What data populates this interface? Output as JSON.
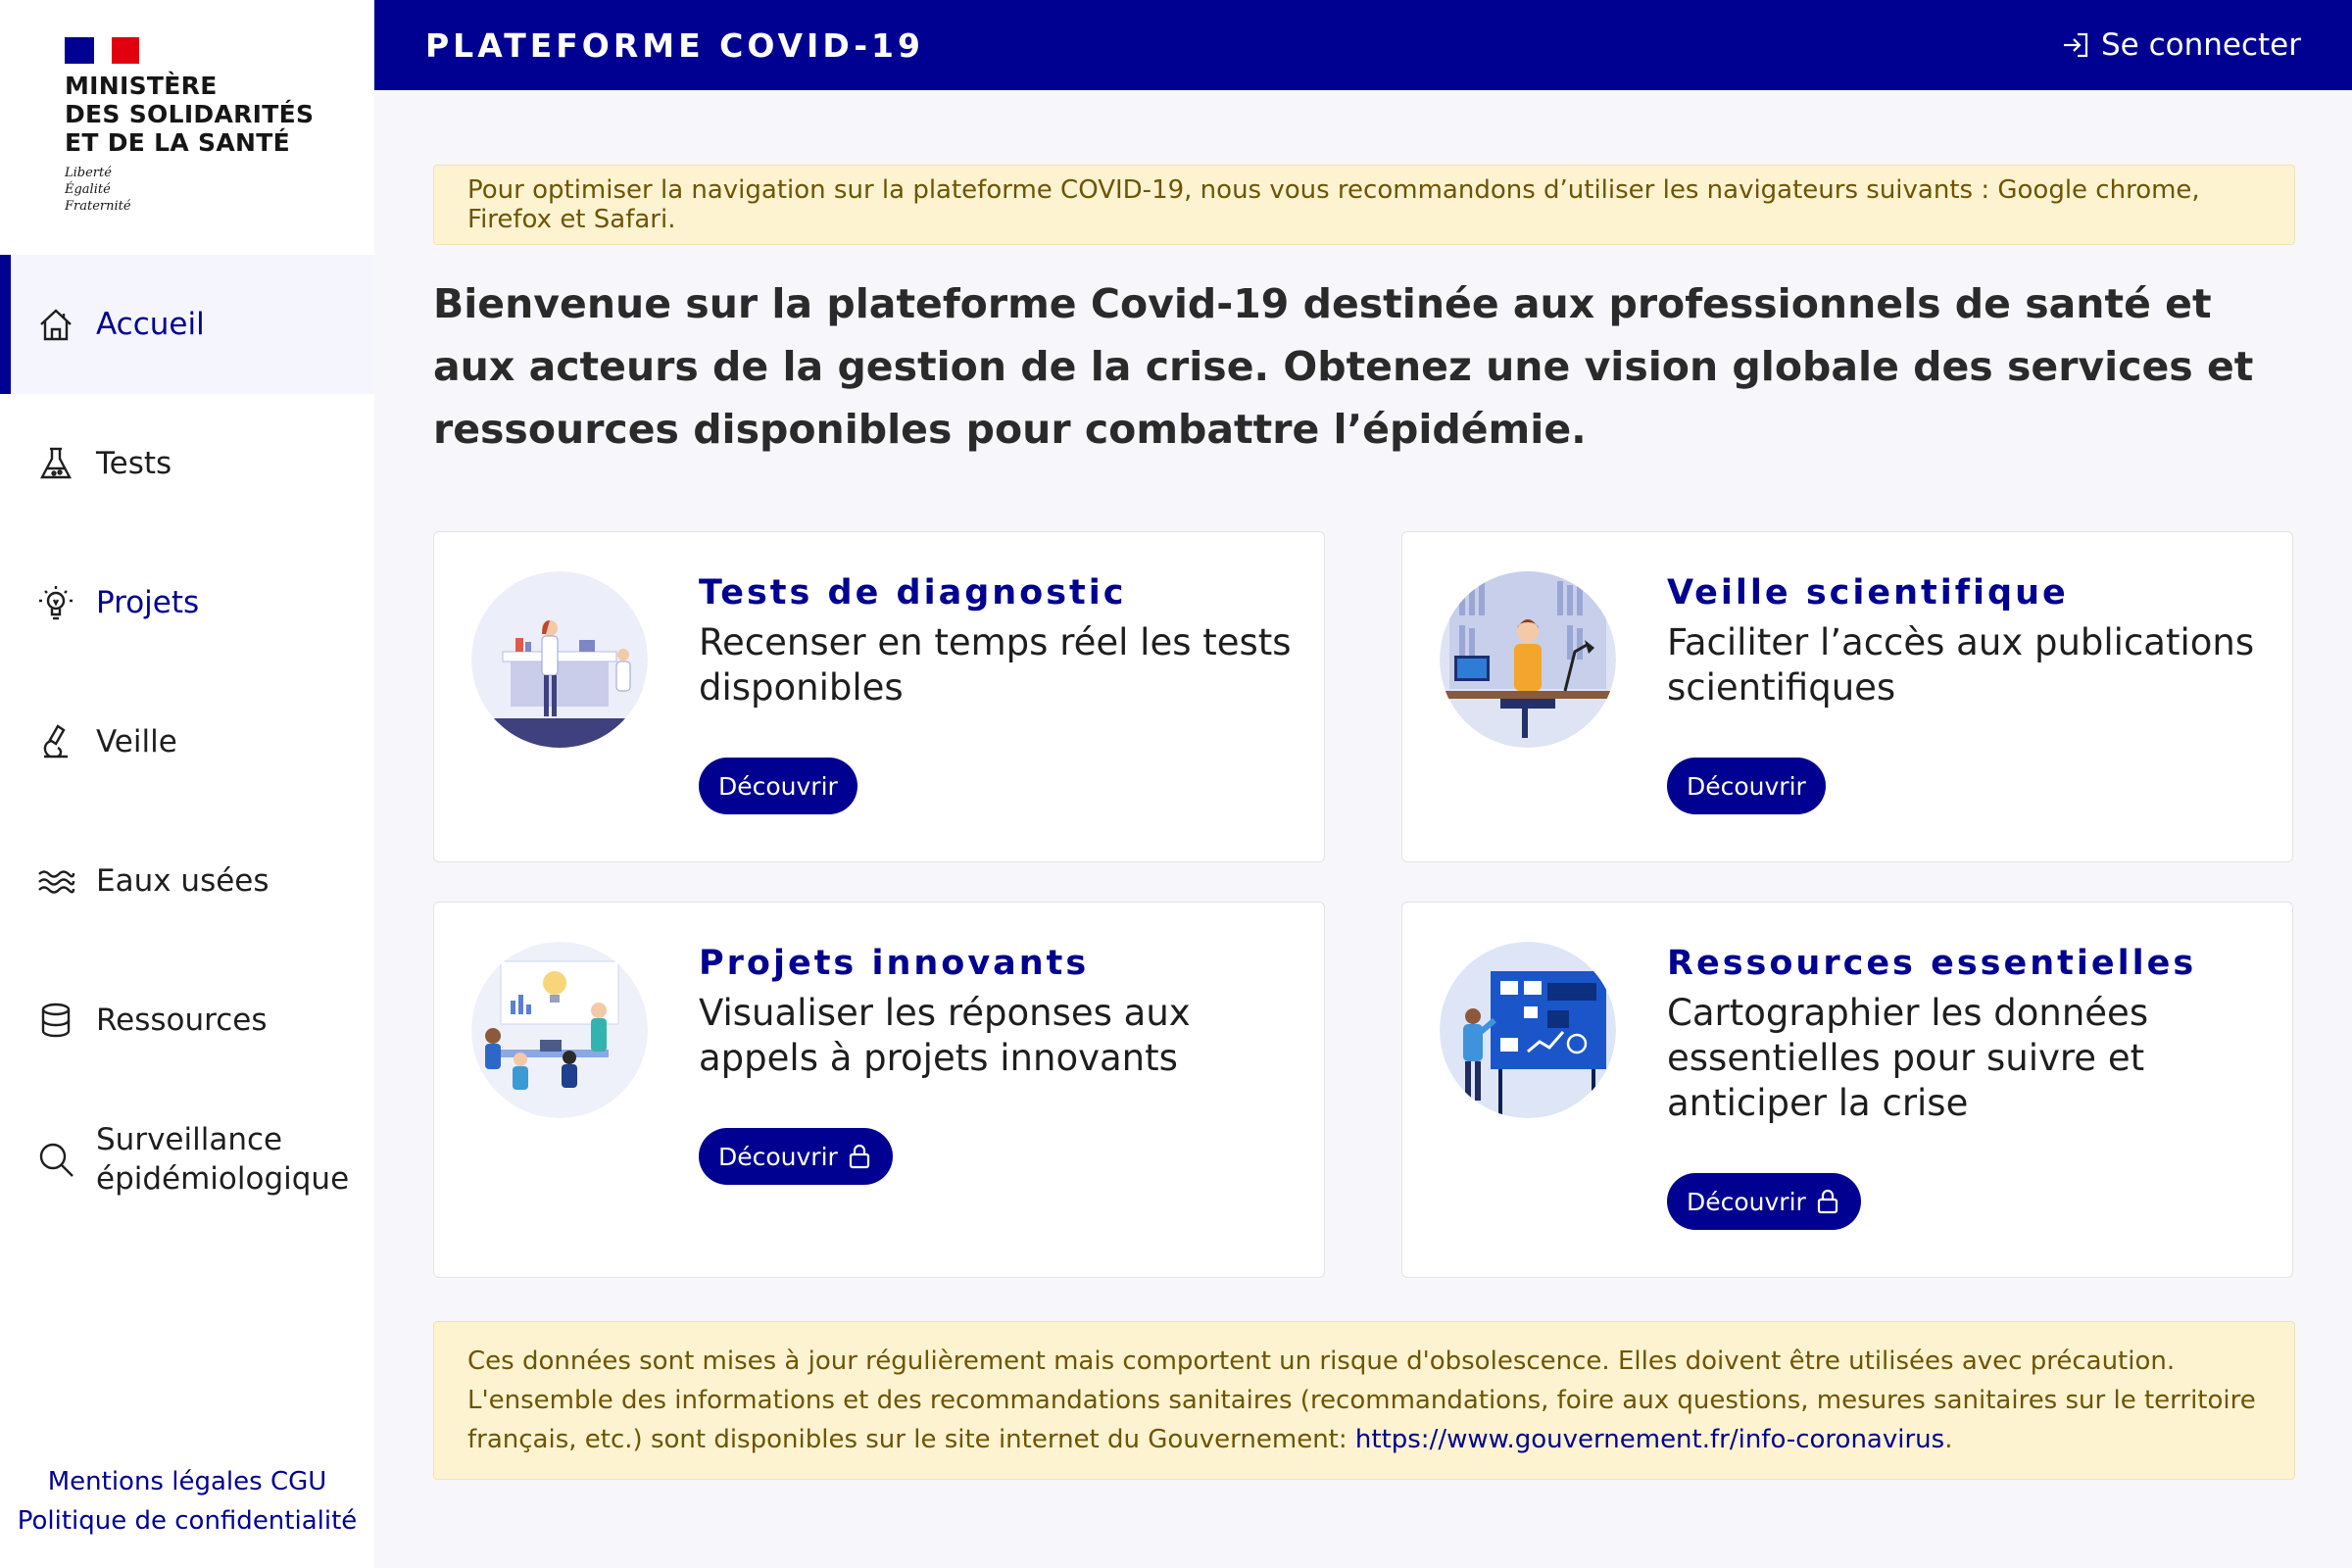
{
  "ministry": {
    "lines": [
      "MINISTÈRE",
      "DES SOLIDARITÉS",
      "ET DE LA SANTÉ"
    ],
    "devise": [
      "Liberté",
      "Égalité",
      "Fraternité"
    ]
  },
  "nav": {
    "items": [
      {
        "label": "Accueil",
        "icon": "home-icon"
      },
      {
        "label": "Tests",
        "icon": "flask-icon"
      },
      {
        "label": "Projets",
        "icon": "lightbulb-icon"
      },
      {
        "label": "Veille",
        "icon": "microscope-icon"
      },
      {
        "label": "Eaux usées",
        "icon": "waves-icon"
      },
      {
        "label": "Ressources",
        "icon": "database-icon"
      },
      {
        "label": "Surveillance épidémiologique",
        "icon": "search-icon"
      }
    ]
  },
  "footer": {
    "mentions": "Mentions légales",
    "cgu": "CGU",
    "privacy": "Politique de confidentialité"
  },
  "header": {
    "title": "PLATEFORME COVID-19",
    "login": "Se connecter"
  },
  "notice_top": "Pour optimiser la navigation sur la plateforme COVID-19, nous vous recommandons d’utiliser les navigateurs suivants : Google chrome, Firefox et Safari.",
  "intro": "Bienvenue sur la plateforme Covid-19 destinée aux professionnels de santé et aux acteurs de la gestion de la crise. Obtenez une vision globale des services et ressources disponibles pour combattre l’épidémie.",
  "cards": [
    {
      "title": "Tests de diagnostic",
      "desc": "Recenser en temps réel les tests disponibles",
      "button": "Découvrir",
      "locked": false
    },
    {
      "title": "Veille scientifique",
      "desc": "Faciliter l’accès aux publications scientifiques",
      "button": "Découvrir",
      "locked": false
    },
    {
      "title": "Projets innovants",
      "desc": "Visualiser les réponses aux appels à projets innovants",
      "button": "Découvrir",
      "locked": true
    },
    {
      "title": "Ressources essentielles",
      "desc": "Cartographier les données essentielles pour suivre et anticiper la crise",
      "button": "Découvrir",
      "locked": true
    }
  ],
  "notice_bottom": {
    "text": "Ces données sont mises à jour régulièrement mais comportent un risque d'obsolescence. Elles doivent être utilisées avec précaution. L'ensemble des informations et des recommandations sanitaires (recommandations, foire aux questions, mesures sanitaires sur le territoire français, etc.) sont disponibles sur le site internet du Gouvernement: ",
    "link": "https://www.gouvernement.fr/info-coronavirus",
    "end": "."
  },
  "colors": {
    "primary": "#000091",
    "alert_bg": "#fdf3d1",
    "alert_text": "#6e5400",
    "flag_red": "#e1000f"
  }
}
